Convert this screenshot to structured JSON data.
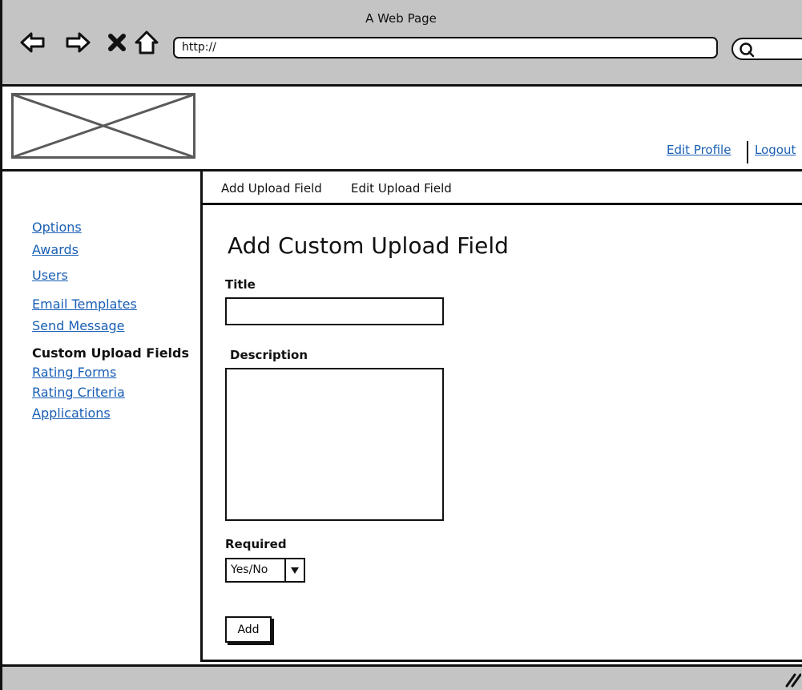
{
  "browser": {
    "window_title": "A Web Page",
    "url": "http://",
    "nav_icons": [
      "back-arrow-icon",
      "forward-arrow-icon",
      "stop-icon",
      "home-icon"
    ],
    "search_icon": "search-icon"
  },
  "header": {
    "logo_icon": "image-placeholder-icon",
    "links": {
      "edit_profile": "Edit Profile",
      "logout": "Logout"
    }
  },
  "sidebar": {
    "items": [
      {
        "label": "Options",
        "active": false
      },
      {
        "label": "Awards",
        "active": false
      },
      {
        "label": "Users",
        "active": false
      },
      {
        "label": "Email Templates",
        "active": false
      },
      {
        "label": "Send Message",
        "active": false
      },
      {
        "label": "Custom Upload Fields",
        "active": true
      },
      {
        "label": "Rating Forms",
        "active": false
      },
      {
        "label": "Rating Criteria",
        "active": false
      },
      {
        "label": "Applications",
        "active": false
      }
    ]
  },
  "tabs": [
    "Add Upload Field",
    "Edit Upload Field"
  ],
  "form": {
    "heading": "Add Custom Upload Field",
    "title_label": "Title",
    "title_value": "",
    "description_label": "Description",
    "description_value": "",
    "required_label": "Required",
    "required_selected": "Yes/No",
    "submit_label": "Add"
  },
  "colors": {
    "chrome": "#c4c4c4",
    "link": "#1a5fb4",
    "border": "#111111"
  }
}
